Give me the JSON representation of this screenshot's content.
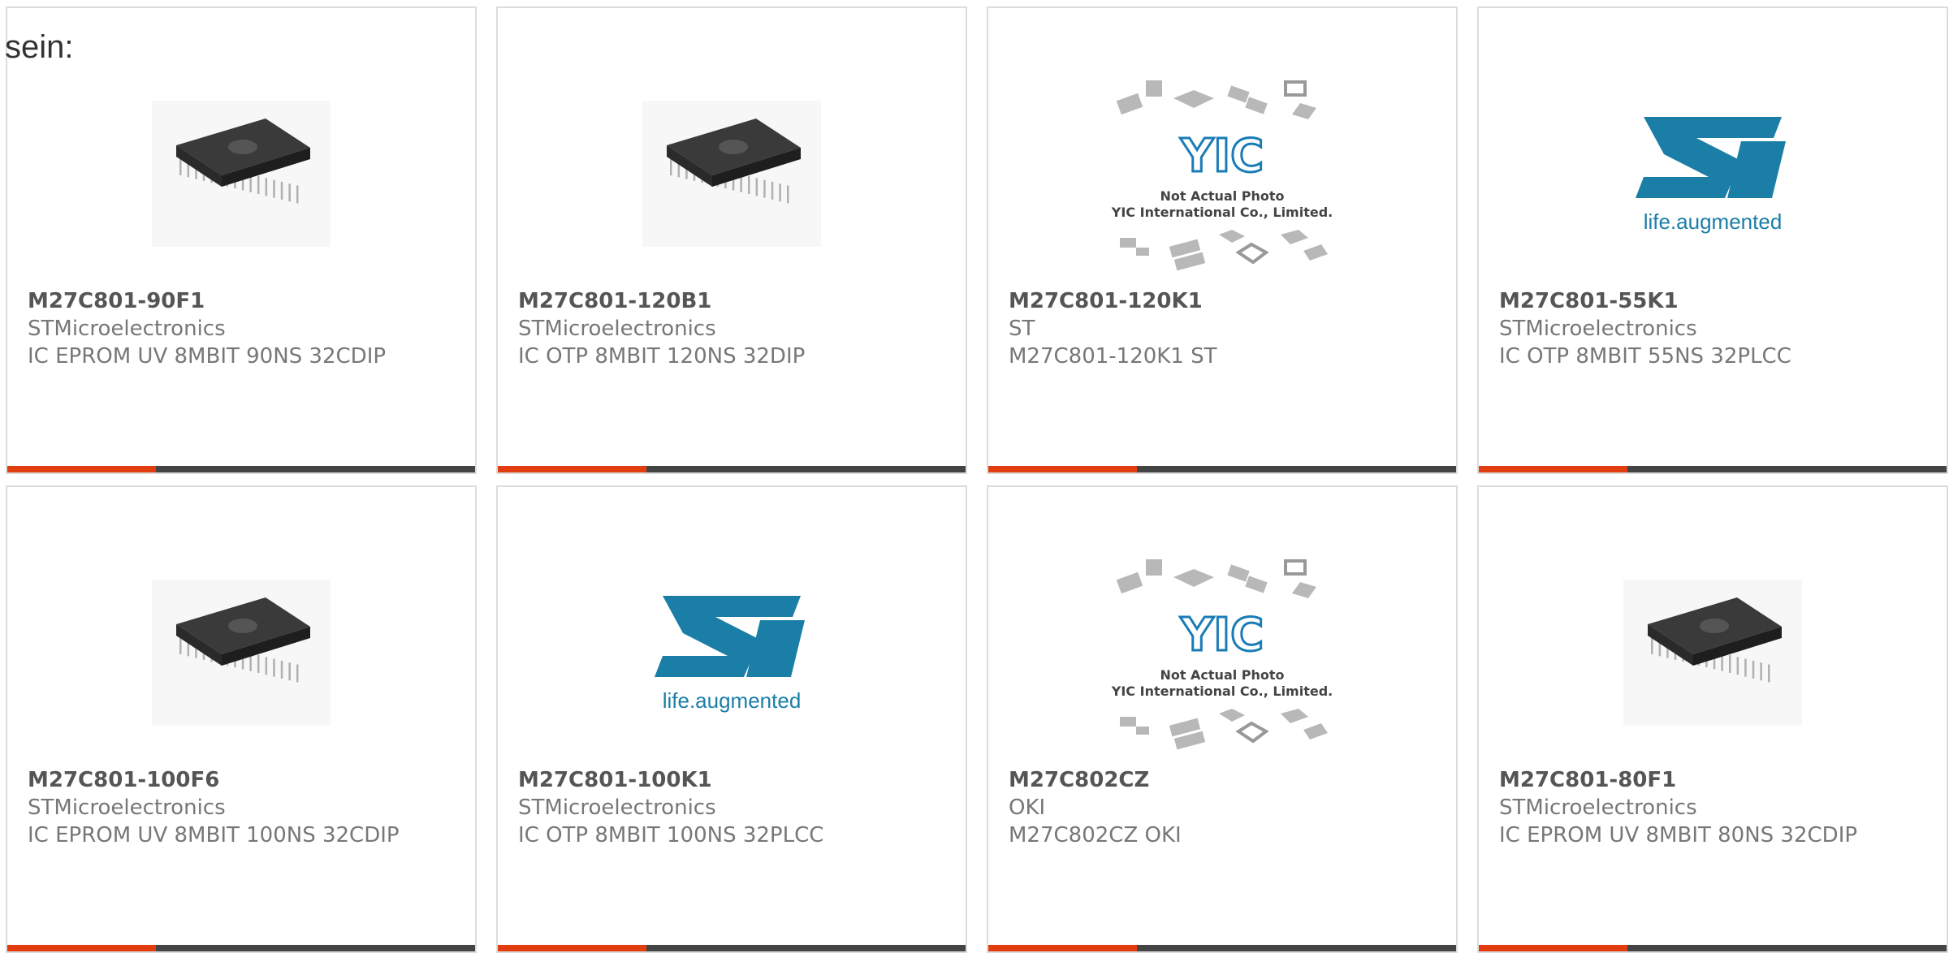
{
  "intro_text": "sein:",
  "colors": {
    "accent": "#e23d0e",
    "bar": "#444444",
    "st_blue": "#1b7ea7",
    "yic_blue": "#1a7cb6"
  },
  "products": [
    {
      "part": "M27C801-90F1",
      "manufacturer": "STMicroelectronics",
      "description": "IC EPROM UV 8MBIT 90NS 32CDIP",
      "image": "dip-chip-icon"
    },
    {
      "part": "M27C801-120B1",
      "manufacturer": "STMicroelectronics",
      "description": "IC OTP 8MBIT 120NS 32DIP",
      "image": "dip-chip-icon"
    },
    {
      "part": "M27C801-120K1",
      "manufacturer": "ST",
      "description": "M27C801-120K1 ST",
      "image": "yic-placeholder-icon",
      "image_text": [
        "YIC",
        "Not Actual Photo",
        "YIC International Co., Limited."
      ]
    },
    {
      "part": "M27C801-55K1",
      "manufacturer": "STMicroelectronics",
      "description": "IC OTP 8MBIT 55NS 32PLCC",
      "image": "st-logo-icon",
      "image_text": [
        "life.augmented"
      ]
    },
    {
      "part": "M27C801-100F6",
      "manufacturer": "STMicroelectronics",
      "description": "IC EPROM UV 8MBIT 100NS 32CDIP",
      "image": "dip-chip-icon"
    },
    {
      "part": "M27C801-100K1",
      "manufacturer": "STMicroelectronics",
      "description": "IC OTP 8MBIT 100NS 32PLCC",
      "image": "st-logo-icon",
      "image_text": [
        "life.augmented"
      ]
    },
    {
      "part": "M27C802CZ",
      "manufacturer": "OKI",
      "description": "M27C802CZ OKI",
      "image": "yic-placeholder-icon",
      "image_text": [
        "YIC",
        "Not Actual Photo",
        "YIC International Co., Limited."
      ]
    },
    {
      "part": "M27C801-80F1",
      "manufacturer": "STMicroelectronics",
      "description": "IC EPROM UV 8MBIT 80NS 32CDIP",
      "image": "dip-chip-icon"
    }
  ]
}
